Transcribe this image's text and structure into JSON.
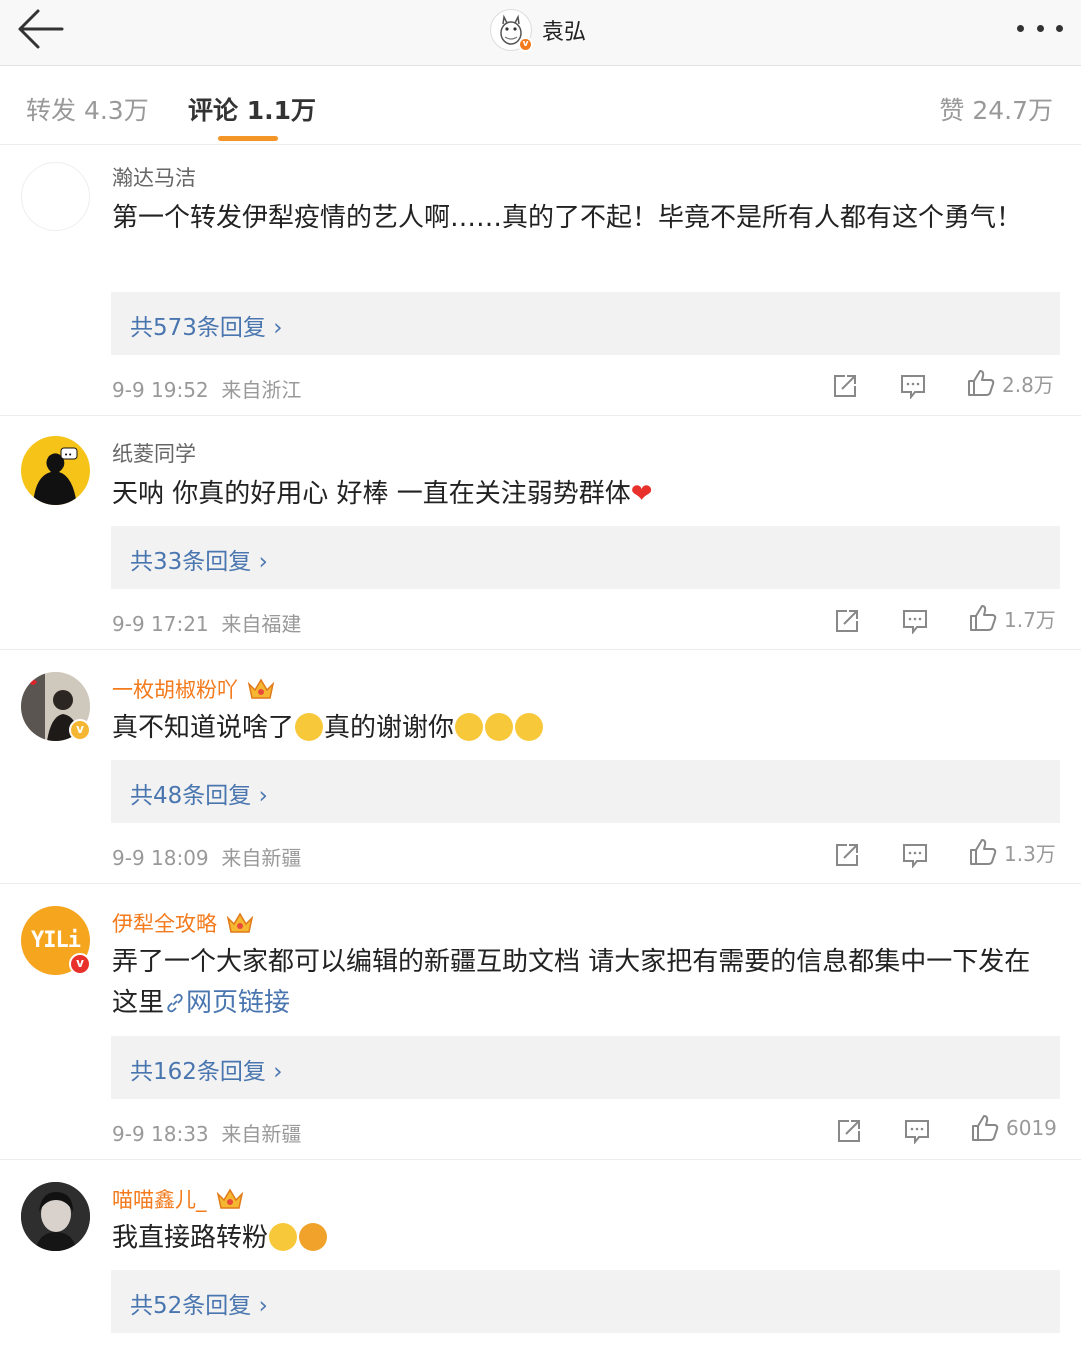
{
  "header": {
    "title": "袁弘"
  },
  "tabs": [
    {
      "label": "转发 4.3万"
    },
    {
      "label": "评论 1.1万"
    },
    {
      "label": "赞 24.7万"
    }
  ],
  "comments": [
    {
      "name": "瀚达马洁",
      "text": "第一个转发伊犁疫情的艺人啊……真的了不起！毕竟不是所有人都有这个勇气！",
      "replies": "共573条回复",
      "time": "9-9 19:52",
      "source": "来自浙江",
      "likes": "2.8万"
    },
    {
      "name": "纸菱同学",
      "text": "天呐 你真的好用心 好棒 一直在关注弱势群体",
      "heart": "❤",
      "replies": "共33条回复",
      "time": "9-9 17:21",
      "source": "来自福建",
      "likes": "1.7万"
    },
    {
      "name": "一枚胡椒粉吖",
      "text_a": "真不知道说啥了",
      "text_b": "真的谢谢你",
      "replies": "共48条回复",
      "time": "9-9 18:09",
      "source": "来自新疆",
      "likes": "1.3万"
    },
    {
      "name": "伊犁全攻略",
      "avatar_text": "YILi",
      "text": "弄了一个大家都可以编辑的新疆互助文档 请大家把有需要的信息都集中一下发在这里",
      "link_label": "网页链接",
      "replies": "共162条回复",
      "time": "9-9 18:33",
      "source": "来自新疆",
      "likes": "6019"
    },
    {
      "name": "喵喵鑫儿_",
      "text": "我直接路转粉",
      "replies": "共52条回复"
    }
  ],
  "colors": {
    "accent": "#f49527",
    "link": "#4a76b0",
    "vip_name": "#f37b1d"
  }
}
